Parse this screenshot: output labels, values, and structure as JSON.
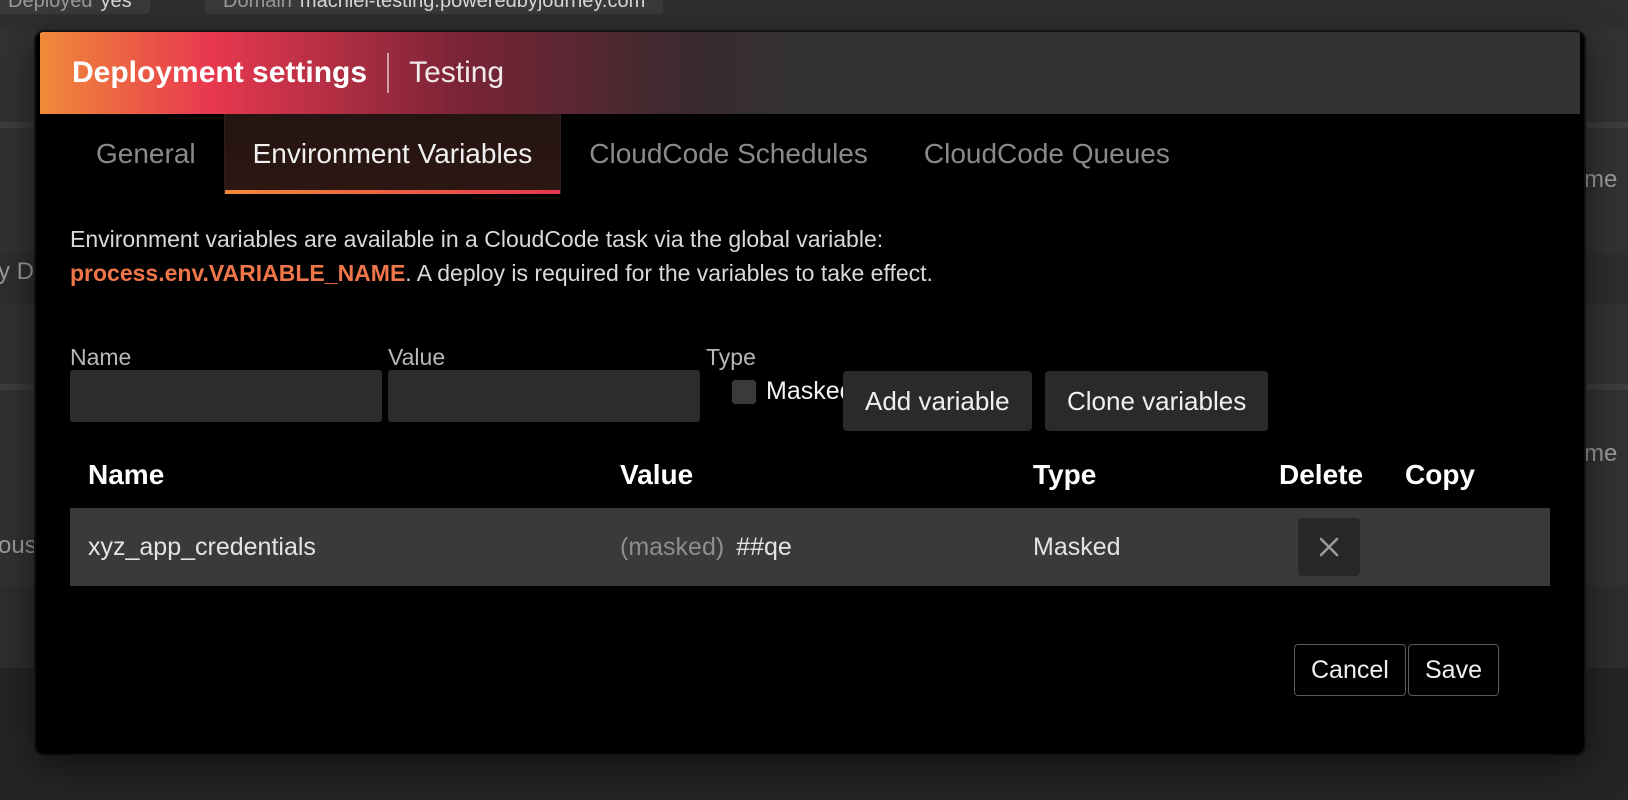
{
  "background": {
    "pills": [
      {
        "label": "Deployed",
        "value": "yes"
      },
      {
        "label": "Domain",
        "value": "machiel-testing.poweredbyjourney.com"
      }
    ],
    "edge_left": [
      "y De",
      "ously"
    ],
    "edge_right": [
      "yme",
      "yme"
    ]
  },
  "modal": {
    "title": "Deployment settings",
    "subtitle": "Testing"
  },
  "tabs": [
    {
      "label": "General"
    },
    {
      "label": "Environment Variables",
      "active": true
    },
    {
      "label": "CloudCode Schedules"
    },
    {
      "label": "CloudCode Queues"
    }
  ],
  "description": {
    "line1": "Environment variables are available in a CloudCode task via the global variable:",
    "code": "process.env.VARIABLE_NAME",
    "line2": ". A deploy is required for the variables to take effect."
  },
  "form": {
    "name_label": "Name",
    "name_value": "",
    "value_label": "Value",
    "value_value": "",
    "type_label": "Type",
    "masked_label": "Masked",
    "masked_checked": false,
    "add_button": "Add variable",
    "clone_button": "Clone variables"
  },
  "table": {
    "headers": {
      "name": "Name",
      "value": "Value",
      "type": "Type",
      "delete": "Delete",
      "copy": "Copy"
    },
    "rows": [
      {
        "name": "xyz_app_credentials",
        "value_prefix": "(masked)",
        "value": "##qe",
        "type": "Masked"
      }
    ]
  },
  "footer": {
    "cancel": "Cancel",
    "save": "Save"
  },
  "colors": {
    "accent_orange": "#f08a3a",
    "accent_red": "#e8384f",
    "code_highlight": "#f0764a"
  },
  "icons": {
    "delete": "close-icon"
  }
}
